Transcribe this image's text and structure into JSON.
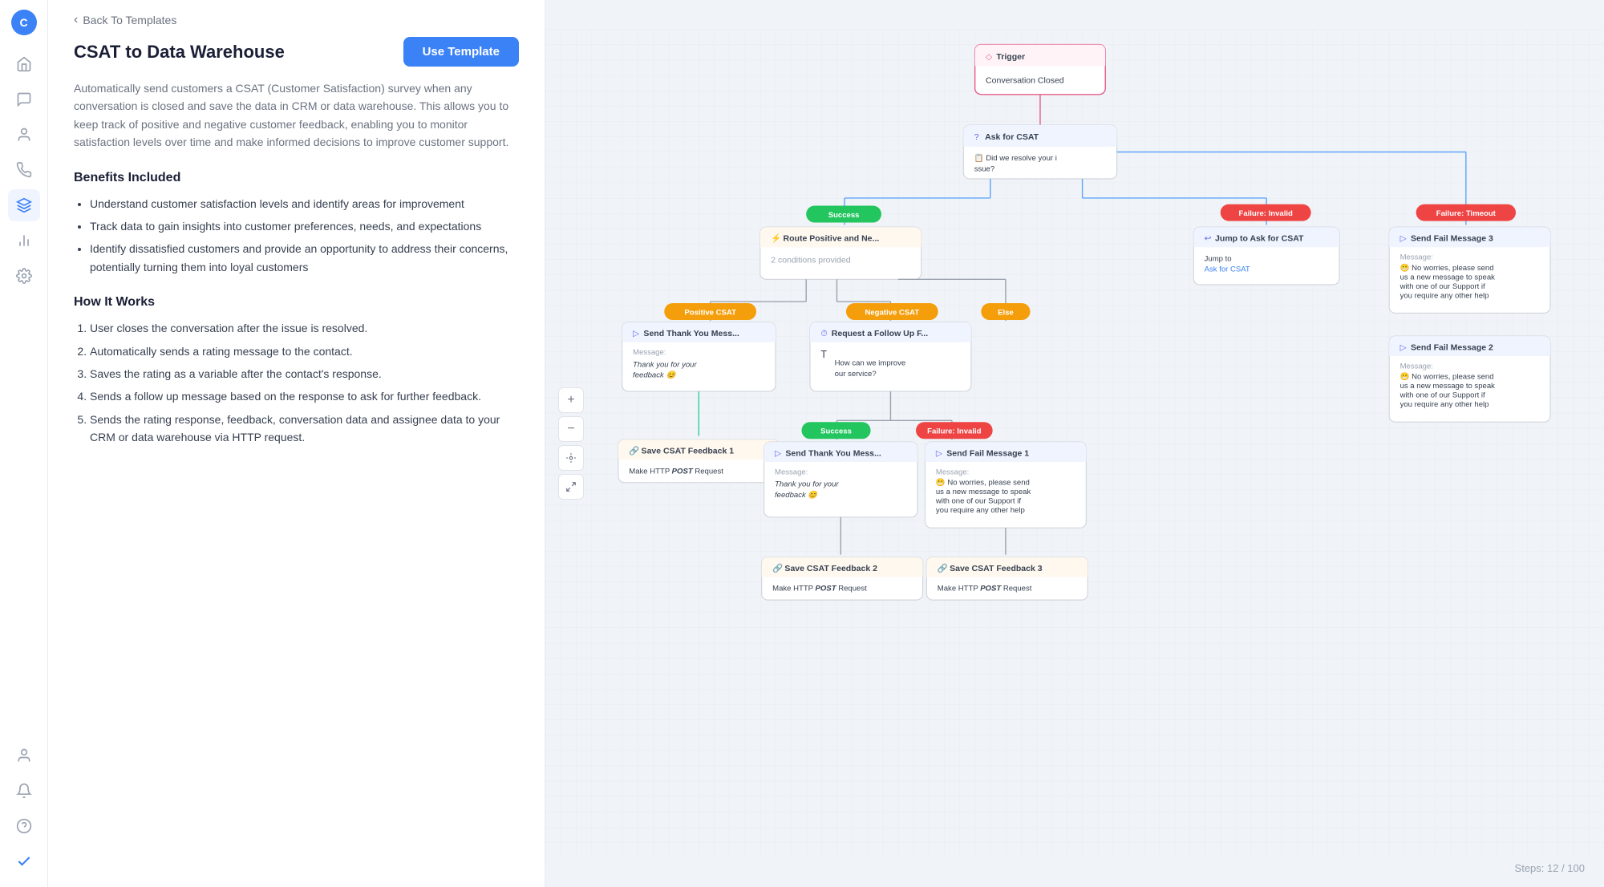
{
  "sidebar": {
    "avatar_label": "C",
    "items": [
      {
        "id": "home",
        "icon": "⌂",
        "label": "home-icon"
      },
      {
        "id": "conversations",
        "icon": "💬",
        "label": "conversations-icon"
      },
      {
        "id": "contacts",
        "icon": "👤",
        "label": "contacts-icon"
      },
      {
        "id": "campaigns",
        "icon": "📡",
        "label": "campaigns-icon"
      },
      {
        "id": "automation",
        "icon": "⬡",
        "label": "automation-icon",
        "active": true
      },
      {
        "id": "reports",
        "icon": "📊",
        "label": "reports-icon"
      },
      {
        "id": "settings",
        "icon": "⚙",
        "label": "settings-icon"
      }
    ],
    "bottom_items": [
      {
        "id": "profile",
        "icon": "👤",
        "label": "profile-icon"
      },
      {
        "id": "notifications",
        "icon": "🔔",
        "label": "notifications-icon"
      },
      {
        "id": "help",
        "icon": "❓",
        "label": "help-icon"
      },
      {
        "id": "status",
        "icon": "✓",
        "label": "status-icon"
      }
    ]
  },
  "panel": {
    "back_link": "Back To Templates",
    "title": "CSAT to Data Warehouse",
    "use_template_label": "Use Template",
    "description": "Automatically send customers a CSAT (Customer Satisfaction) survey when any conversation is closed and save the data in CRM or data warehouse. This allows you to keep track of positive and negative customer feedback, enabling you to monitor satisfaction levels over time and make informed decisions to improve customer support.",
    "benefits_title": "Benefits Included",
    "benefits": [
      "Understand customer satisfaction levels and identify areas for improvement",
      "Track data to gain insights into customer preferences, needs, and expectations",
      "Identify dissatisfied customers and provide an opportunity to address their concerns, potentially turning them into loyal customers"
    ],
    "how_title": "How It Works",
    "steps": [
      "User closes the conversation after the issue is resolved.",
      "Automatically sends a rating message to the contact.",
      "Saves the rating as a variable after the contact's response.",
      "Sends a follow up message based on the response to ask for further feedback.",
      "Sends the rating response, feedback, conversation data and assignee data to your CRM or data warehouse via HTTP request."
    ]
  },
  "flow": {
    "steps_label": "Steps: 12 / 100",
    "trigger_label": "Trigger",
    "trigger_sub": "Conversation Closed",
    "ask_csat_label": "Ask for CSAT",
    "ask_csat_sub": "Did we resolve your issue?",
    "route_label": "Route Positive and Ne...",
    "route_sub": "2 conditions provided",
    "badges": {
      "success": "Success",
      "failure_invalid": "Failure: Invalid",
      "failure_timeout": "Failure: Timeout",
      "positive_csat": "Positive CSAT",
      "negative_csat": "Negative CSAT",
      "else": "Else",
      "success2": "Success",
      "failure_invalid2": "Failure: Invalid"
    },
    "nodes": {
      "send_thank_you_1": {
        "title": "Send Thank You Mess...",
        "body": "Message:\nThank you for your feedback 😊"
      },
      "request_followup": {
        "title": "Request a Follow Up F...",
        "body": "How can we improve our service?"
      },
      "jump_to_ask": {
        "title": "Jump to Ask for CSAT",
        "body": "Jump to\nAsk for CSAT"
      },
      "send_fail_3": {
        "title": "Send Fail Message 3",
        "body": "Message:\n😬 No worries, please send us a new message to speak with one of our Support if you require any other help"
      },
      "send_fail_2": {
        "title": "Send Fail Message 2",
        "body": "Message:\n😬 No worries, please send us a new message to speak with one of our Support if you require any other help"
      },
      "save_csat_1": {
        "title": "Save CSAT Feedback 1",
        "body": "Make HTTP POST Request"
      },
      "send_thank_you_2": {
        "title": "Send Thank You Mess...",
        "body": "Message:\nThank you for your feedback 😊"
      },
      "send_fail_1": {
        "title": "Send Fail Message 1",
        "body": "Message:\n😬 No worries, please send us a new message to speak with one of our Support if you require any other help"
      },
      "save_csat_2": {
        "title": "Save CSAT Feedback 2",
        "body": "Make HTTP POST Request"
      },
      "save_csat_3": {
        "title": "Save CSAT Feedback 3",
        "body": "Make HTTP POST Request"
      }
    }
  }
}
